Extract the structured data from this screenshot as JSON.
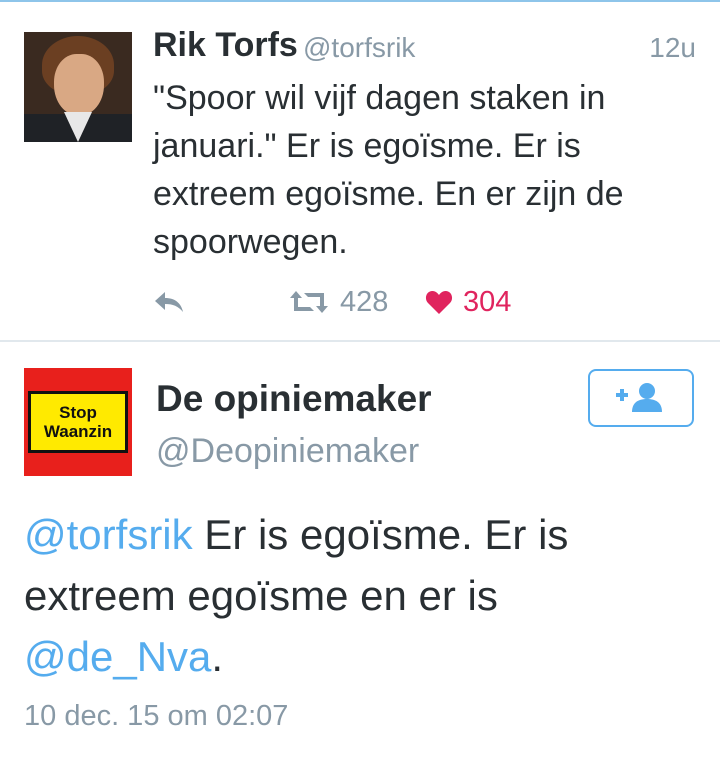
{
  "tweet1": {
    "name": "Rik Torfs",
    "handle": "@torfsrik",
    "time": "12u",
    "text": "\"Spoor wil vijf dagen staken in januari.\" Er is egoïsme. Er is extreem egoïsme. En er zijn de spoorwegen.",
    "avatar_icon": "profile-photo",
    "actions": {
      "reply_icon": "reply-icon",
      "retweet_icon": "retweet-icon",
      "retweets": "428",
      "like_icon": "heart-icon",
      "likes": "304",
      "like_color": "#e0245e"
    }
  },
  "tweet2": {
    "name": "De opiniemaker",
    "handle": "@Deopiniemaker",
    "avatar_sign": {
      "line1": "Stop",
      "line2": "Waanzin"
    },
    "follow_icon": "follow-user-icon",
    "text_parts": {
      "mention1": "@torfsrik",
      "middle": " Er is egoïsme. Er is extreem egoïsme en er is ",
      "mention2": "@de_Nva",
      "end": "."
    },
    "date": "10 dec. 15 om 02:07"
  },
  "colors": {
    "accent": "#55acee",
    "secondary_text": "#8899a6",
    "primary_text": "#292f33"
  }
}
